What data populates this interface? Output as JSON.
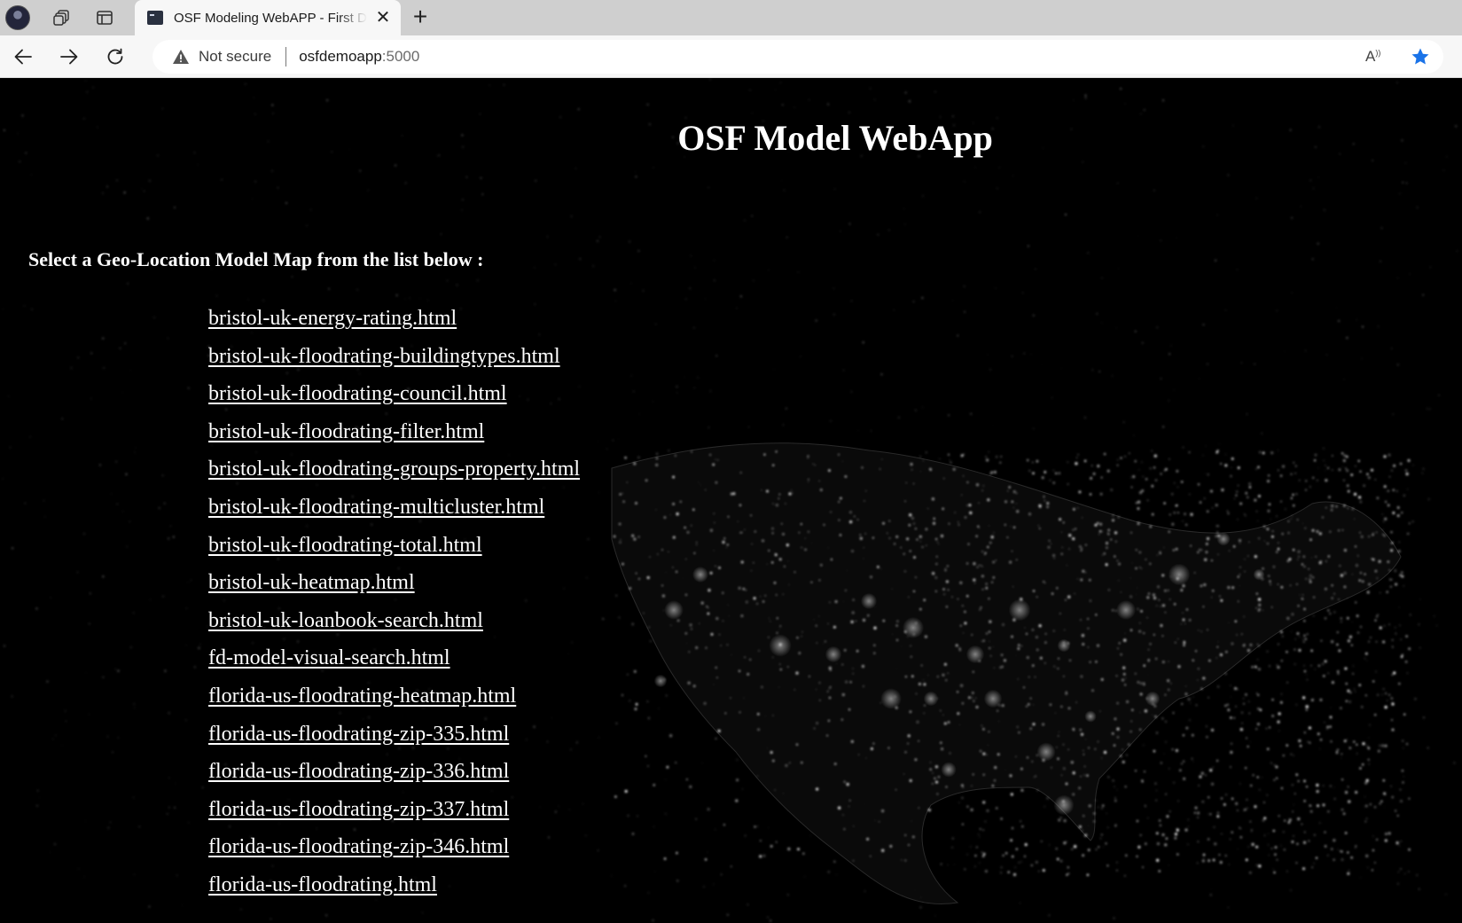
{
  "browser": {
    "tab_title": "OSF Modeling WebAPP - First Demo",
    "tab_close": "✕",
    "new_tab": "+",
    "security_label": "Not secure",
    "url_host": "osfdemoapp",
    "url_port": ":5000",
    "read_aloud": "A",
    "accent_color": "#1a73e8"
  },
  "page": {
    "title": "OSF Model WebApp",
    "select_label": "Select a Geo-Location Model Map from the list below :",
    "links": [
      "bristol-uk-energy-rating.html",
      "bristol-uk-floodrating-buildingtypes.html",
      "bristol-uk-floodrating-council.html",
      "bristol-uk-floodrating-filter.html",
      "bristol-uk-floodrating-groups-property.html",
      "bristol-uk-floodrating-multicluster.html",
      "bristol-uk-floodrating-total.html",
      "bristol-uk-heatmap.html",
      "bristol-uk-loanbook-search.html",
      "fd-model-visual-search.html",
      "florida-us-floodrating-heatmap.html",
      "florida-us-floodrating-zip-335.html",
      "florida-us-floodrating-zip-336.html",
      "florida-us-floodrating-zip-337.html",
      "florida-us-floodrating-zip-346.html",
      "florida-us-floodrating.html"
    ]
  }
}
